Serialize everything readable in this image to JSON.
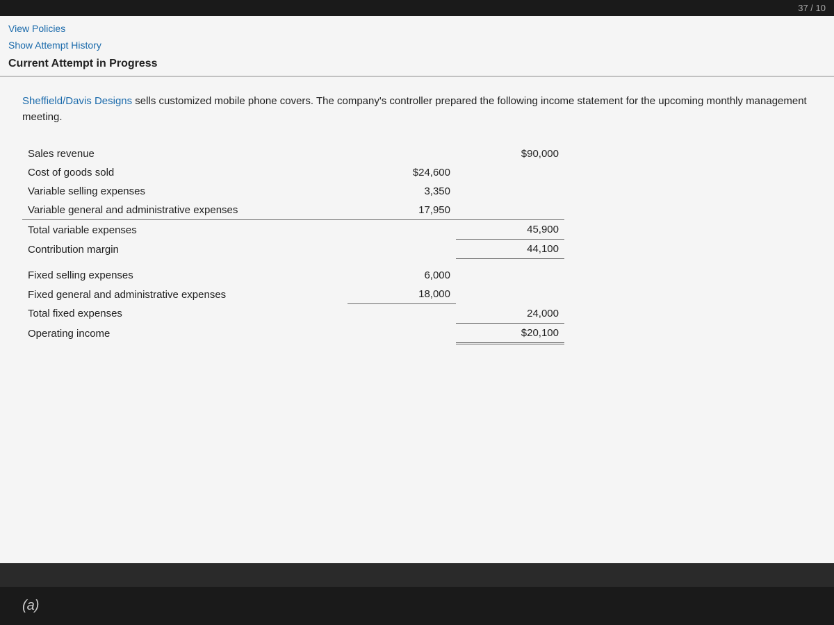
{
  "topbar": {
    "score": "37 / 10"
  },
  "nav": {
    "view_policies": "View Policies",
    "show_attempt_history": "Show Attempt History",
    "current_attempt": "Current Attempt in Progress"
  },
  "problem": {
    "description_part1": "Sheffield/Davis Designs",
    "description_part2": " sells customized mobile phone covers. The company's controller prepared the following income statement for the upcoming monthly management meeting.",
    "rows": [
      {
        "label": "Sales revenue",
        "col2": "",
        "col3": "$90,000",
        "style": ""
      },
      {
        "label": "Cost of goods sold",
        "col2": "$24,600",
        "col3": "",
        "style": ""
      },
      {
        "label": "Variable selling expenses",
        "col2": "3,350",
        "col3": "",
        "style": ""
      },
      {
        "label": "Variable general and administrative expenses",
        "col2": "17,950",
        "col3": "",
        "style": "border-bottom"
      },
      {
        "label": "Total variable expenses",
        "col2": "",
        "col3": "45,900",
        "style": ""
      },
      {
        "label": "Contribution margin",
        "col2": "",
        "col3": "44,100",
        "style": ""
      },
      {
        "label": "Fixed selling expenses",
        "col2": "6,000",
        "col3": "",
        "style": ""
      },
      {
        "label": "Fixed general and administrative expenses",
        "col2": "18,000",
        "col3": "",
        "style": "border-bottom"
      },
      {
        "label": "Total fixed expenses",
        "col2": "",
        "col3": "24,000",
        "style": ""
      },
      {
        "label": "Operating income",
        "col2": "",
        "col3": "$20,100",
        "style": "double-underline"
      }
    ]
  },
  "footer": {
    "label": "(a)"
  }
}
